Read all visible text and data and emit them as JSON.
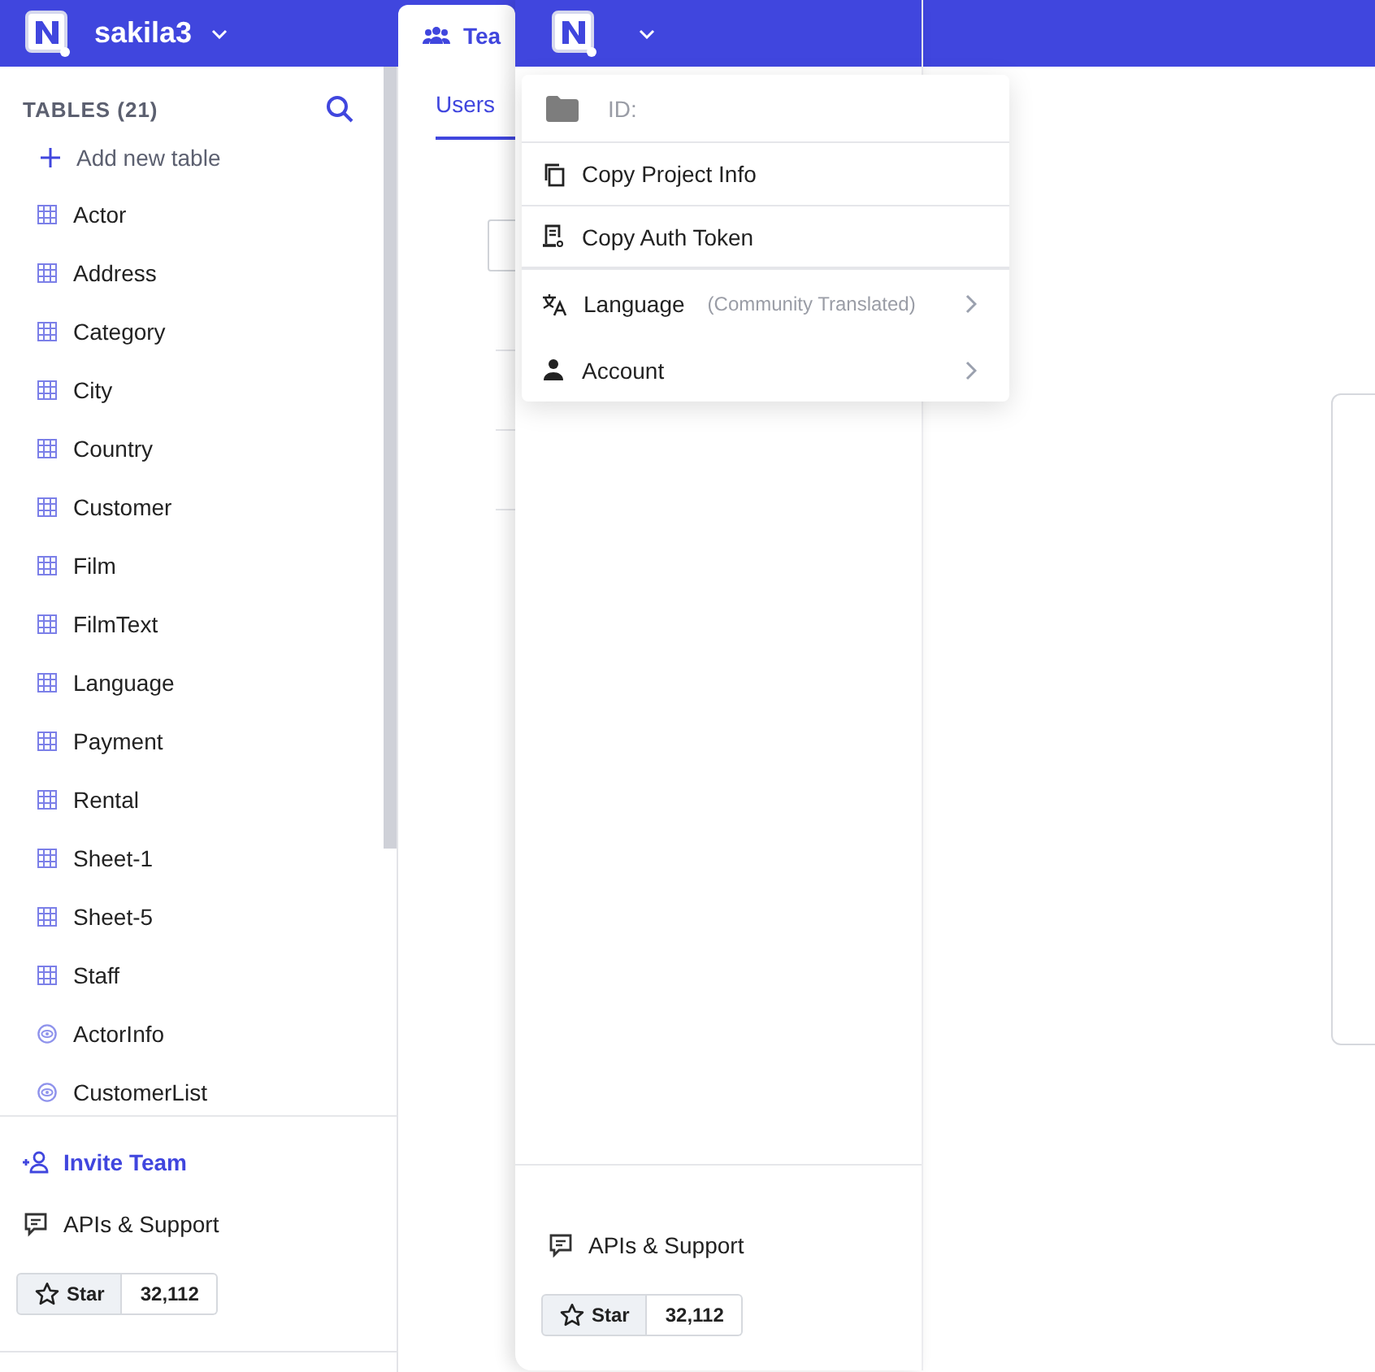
{
  "sidebar": {
    "project": "sakila3",
    "tables_heading": "TABLES (21)",
    "add_table": "Add new table",
    "tables": [
      {
        "name": "Actor",
        "kind": "table"
      },
      {
        "name": "Address",
        "kind": "table"
      },
      {
        "name": "Category",
        "kind": "table"
      },
      {
        "name": "City",
        "kind": "table"
      },
      {
        "name": "Country",
        "kind": "table"
      },
      {
        "name": "Customer",
        "kind": "table"
      },
      {
        "name": "Film",
        "kind": "table"
      },
      {
        "name": "FilmText",
        "kind": "table"
      },
      {
        "name": "Language",
        "kind": "table"
      },
      {
        "name": "Payment",
        "kind": "table"
      },
      {
        "name": "Rental",
        "kind": "table"
      },
      {
        "name": "Sheet-1",
        "kind": "table"
      },
      {
        "name": "Sheet-5",
        "kind": "table"
      },
      {
        "name": "Staff",
        "kind": "table"
      },
      {
        "name": "ActorInfo",
        "kind": "view"
      },
      {
        "name": "CustomerList",
        "kind": "view"
      }
    ],
    "invite": "Invite Team",
    "support": "APIs & Support",
    "star": {
      "label": "Star",
      "count": "32,112"
    }
  },
  "page": {
    "tab": "Tea",
    "subtab": "Users"
  },
  "panel": {
    "support": "APIs & Support",
    "star": {
      "label": "Star",
      "count": "32,112"
    }
  },
  "menu": {
    "id_label": "ID:",
    "items": [
      {
        "label": "Copy Project Info",
        "kind": "copy",
        "submenu": false
      },
      {
        "label": "Copy Auth Token",
        "kind": "token",
        "submenu": false
      },
      {
        "label": "Language",
        "note": "(Community Translated)",
        "kind": "language",
        "submenu": true
      },
      {
        "label": "Account",
        "kind": "account",
        "submenu": true
      }
    ]
  }
}
